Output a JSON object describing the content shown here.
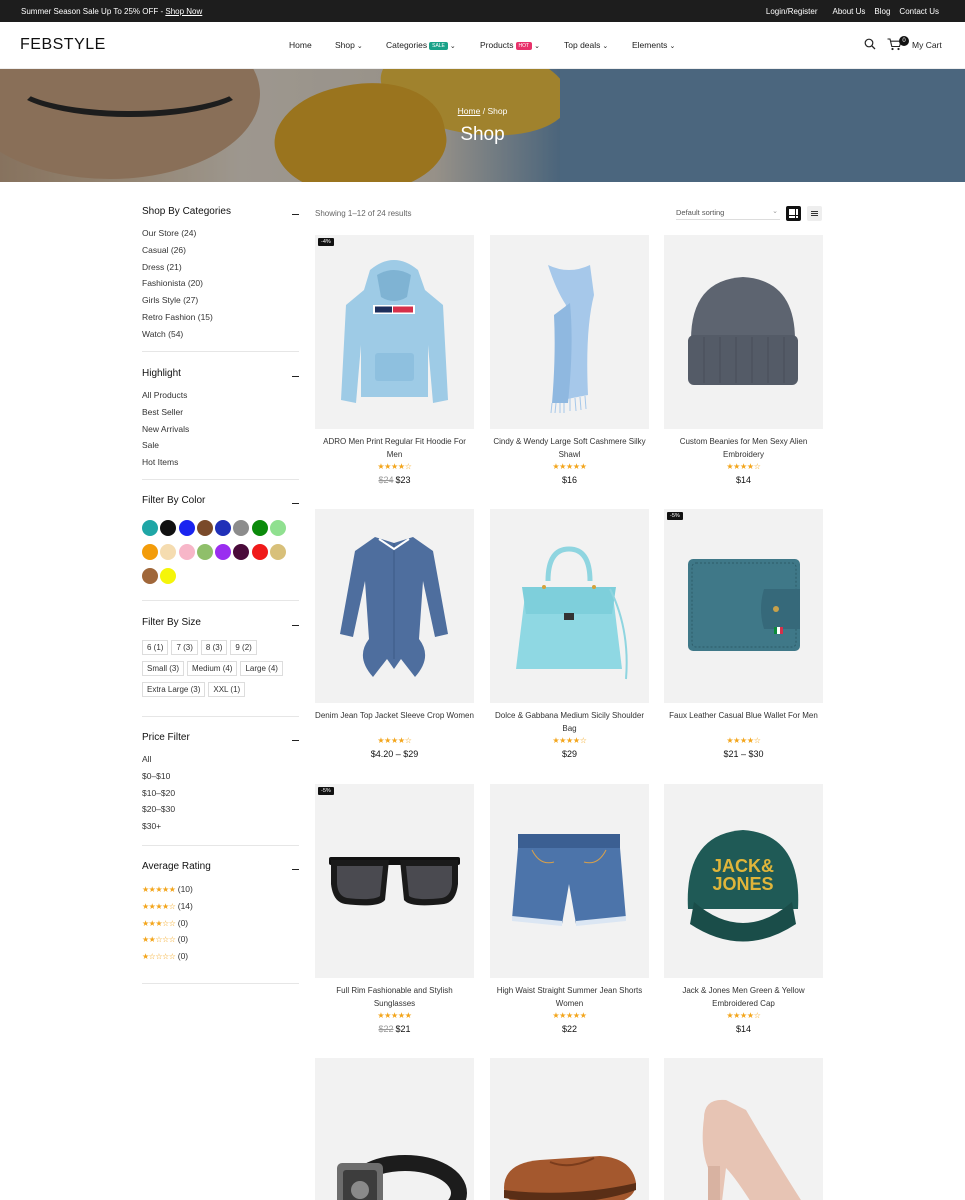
{
  "topbar": {
    "promo_text": "Summer Season Sale Up To 25% OFF - ",
    "promo_link": "Shop Now",
    "links": [
      "Login/Register",
      "About Us",
      "Blog",
      "Contact Us"
    ]
  },
  "header": {
    "logo": "FEBSTYLE",
    "nav": [
      {
        "label": "Home",
        "chevron": false
      },
      {
        "label": "Shop",
        "chevron": true
      },
      {
        "label": "Categories",
        "chevron": true,
        "badge": "SALE",
        "badge_color": "#1aa289"
      },
      {
        "label": "Products",
        "chevron": true,
        "badge": "HOT",
        "badge_color": "#e8326b"
      },
      {
        "label": "Top deals",
        "chevron": true
      },
      {
        "label": "Elements",
        "chevron": true
      }
    ],
    "cart_count": "0",
    "cart_label": "My Cart"
  },
  "hero": {
    "breadcrumb_home": "Home",
    "breadcrumb_sep": "/",
    "breadcrumb_current": "Shop",
    "title": "Shop"
  },
  "sidebar": {
    "categories": {
      "title": "Shop By Categories",
      "items": [
        "Our Store (24)",
        "Casual (26)",
        "Dress (21)",
        "Fashionista (20)",
        "Girls Style (27)",
        "Retro Fashion (15)",
        "Watch (54)"
      ]
    },
    "highlight": {
      "title": "Highlight",
      "items": [
        "All Products",
        "Best Seller",
        "New Arrivals",
        "Sale",
        "Hot Items"
      ]
    },
    "colors": {
      "title": "Filter By Color",
      "swatches": [
        "#1fa6a6",
        "#111111",
        "#1a24f0",
        "#7a4a2a",
        "#2030b8",
        "#8c8c8c",
        "#0b8a0b",
        "#90e090",
        "#f39c0a",
        "#f5dcb0",
        "#f7b6c8",
        "#8fbf6a",
        "#9a2ef0",
        "#4a0a3a",
        "#f01a1a",
        "#d8c07a",
        "#a0673a",
        "#f5f50a"
      ]
    },
    "sizes": {
      "title": "Filter By Size",
      "rows": [
        [
          "6 (1)",
          "7 (3)",
          "8 (3)",
          "9 (2)"
        ],
        [
          "Small (3)",
          "Medium (4)",
          "Large (4)"
        ],
        [
          "Extra Large (3)",
          "XXL (1)"
        ]
      ]
    },
    "price": {
      "title": "Price Filter",
      "items": [
        "All",
        "$0–$10",
        "$10–$20",
        "$20–$30",
        "$30+"
      ]
    },
    "rating": {
      "title": "Average Rating",
      "items": [
        {
          "stars": "★★★★★",
          "count": "(10)"
        },
        {
          "stars": "★★★★☆",
          "count": "(14)"
        },
        {
          "stars": "★★★☆☆",
          "count": "(0)"
        },
        {
          "stars": "★★☆☆☆",
          "count": "(0)"
        },
        {
          "stars": "★☆☆☆☆",
          "count": "(0)"
        }
      ]
    }
  },
  "shop": {
    "result_count": "Showing 1–12 of 24 results",
    "sort_value": "Default sorting",
    "products": [
      {
        "tag": "-4%",
        "name": "ADRO Men Print Regular Fit Hoodie For Men",
        "rating": "★★★★☆",
        "old_price": "$24",
        "price": "$23",
        "image": "hoodie-icon"
      },
      {
        "tag": "",
        "name": "Cindy & Wendy Large Soft Cashmere Silky Shawl",
        "rating": "★★★★★",
        "old_price": "",
        "price": "$16",
        "image": "scarf-icon"
      },
      {
        "tag": "",
        "name": "Custom Beanies for Men Sexy Alien Embroidery",
        "rating": "★★★★☆",
        "old_price": "",
        "price": "$14",
        "image": "beanie-icon"
      },
      {
        "tag": "",
        "name": "Denim Jean Top Jacket Sleeve Crop Women",
        "rating": "★★★★☆",
        "old_price": "",
        "price": "$4.20 – $29",
        "image": "shirt-icon"
      },
      {
        "tag": "",
        "name": "Dolce & Gabbana Medium Sicily Shoulder Bag",
        "rating": "★★★★☆",
        "old_price": "",
        "price": "$29",
        "image": "handbag-icon"
      },
      {
        "tag": "-5%",
        "name": "Faux Leather Casual Blue Wallet For Men",
        "rating": "★★★★☆",
        "old_price": "",
        "price": "$21 – $30",
        "image": "wallet-icon"
      },
      {
        "tag": "-5%",
        "name": "Full Rim Fashionable and Stylish Sunglasses",
        "rating": "★★★★★",
        "old_price": "$22",
        "price": "$21",
        "image": "sunglasses-icon"
      },
      {
        "tag": "",
        "name": "High Waist Straight Summer Jean Shorts Women",
        "rating": "★★★★★",
        "old_price": "",
        "price": "$22",
        "image": "shorts-icon"
      },
      {
        "tag": "",
        "name": "Jack & Jones Men Green & Yellow Embroidered Cap",
        "rating": "★★★★☆",
        "old_price": "",
        "price": "$14",
        "image": "cap-icon",
        "cap_text_1": "JACK&",
        "cap_text_2": "JONES"
      },
      {
        "tag": "",
        "name": "",
        "rating": "",
        "old_price": "",
        "price": "",
        "image": "belt-icon"
      },
      {
        "tag": "",
        "name": "",
        "rating": "",
        "old_price": "",
        "price": "",
        "image": "loafer-icon"
      },
      {
        "tag": "",
        "name": "",
        "rating": "",
        "old_price": "",
        "price": "",
        "image": "heel-icon"
      }
    ]
  }
}
